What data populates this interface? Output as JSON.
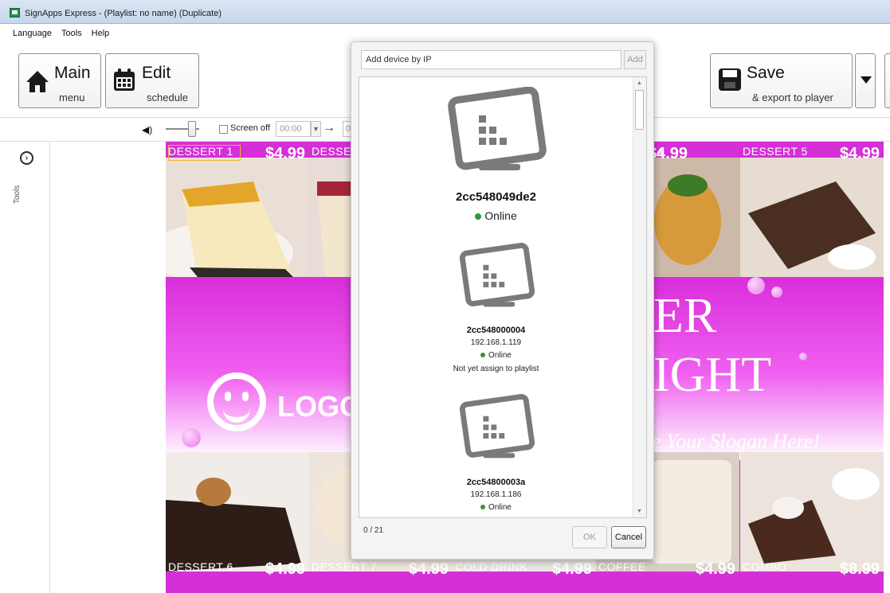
{
  "window": {
    "title": "SignApps Express - (Playlist: no name) (Duplicate)"
  },
  "menubar": {
    "items": [
      "Language",
      "Tools",
      "Help"
    ]
  },
  "toolbar": {
    "main": {
      "big": "Main",
      "small": "menu"
    },
    "edit": {
      "big": "Edit",
      "small": "schedule"
    },
    "save": {
      "big": "Save",
      "small": "& export to player"
    }
  },
  "substrip": {
    "screen_off_label": "Screen off",
    "time_from": "00:00",
    "time_to": "0"
  },
  "sidepanel": {
    "tools_label": "Tools"
  },
  "menuboard": {
    "top_row": [
      {
        "label": "DESSERT 1",
        "price": "$4.99"
      },
      {
        "label": "DESSE",
        "price": ""
      },
      {
        "label": "",
        "price": ""
      },
      {
        "label": "T 4",
        "price": "$4.99"
      },
      {
        "label": "DESSERT 5",
        "price": "$4.99"
      }
    ],
    "bottom_row": [
      {
        "label": "DESSERT 6",
        "price": "$4.99"
      },
      {
        "label": "DESSERT 7",
        "price": "$4.99"
      },
      {
        "label": "COLD DRINK",
        "price": "$4.99"
      },
      {
        "label": "COFFEE",
        "price": "$4.99"
      },
      {
        "label": "COMBO",
        "price": "$8.99"
      }
    ],
    "logo_text": "LOGO",
    "headline_1": "ER",
    "headline_2": "IGHT",
    "slogan": "e Your Slogan Here!"
  },
  "dialog": {
    "ip_placeholder": "Add device by IP",
    "add_label": "Add",
    "devices": [
      {
        "name": "2cc548049de2",
        "ip": "",
        "status": "Online",
        "note": ""
      },
      {
        "name": "2cc548000004",
        "ip": "192.168.1.119",
        "status": "Online",
        "note": "Not yet assign to playlist"
      },
      {
        "name": "2cc54800003a",
        "ip": "192.168.1.186",
        "status": "Online",
        "note": ""
      }
    ],
    "count": "0 / 21",
    "ok_label": "OK",
    "cancel_label": "Cancel",
    "status_color": "#2f9a2f"
  },
  "colors": {
    "board_magenta": "#d52fd8",
    "title_bar": "#c6d6ec"
  }
}
